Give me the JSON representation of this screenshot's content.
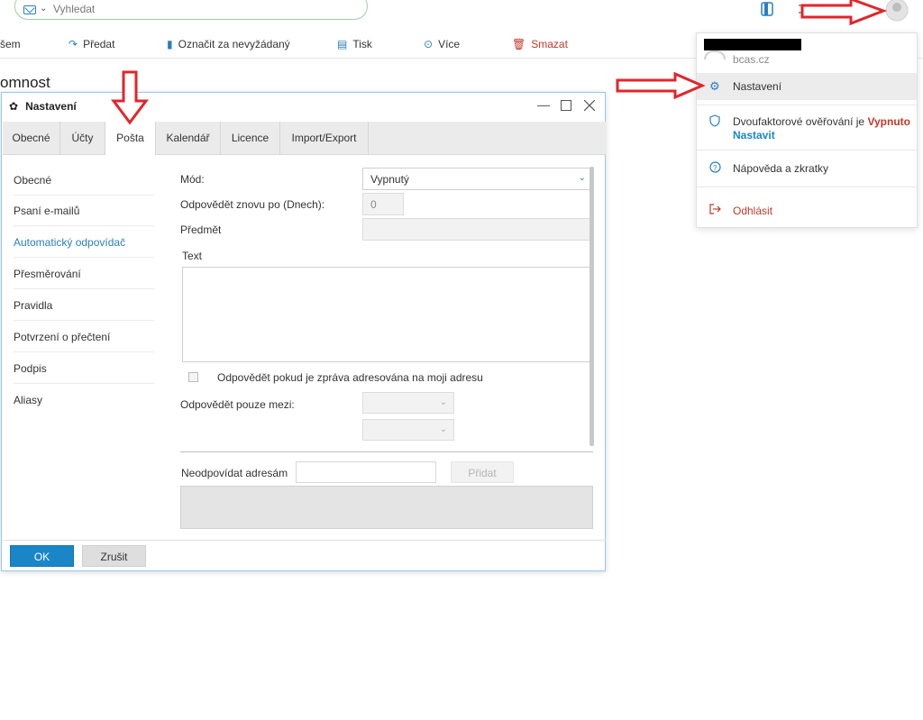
{
  "search": {
    "placeholder": "Vyhledat"
  },
  "toolbar": {
    "items": [
      {
        "label": "šem"
      },
      {
        "label": "Předat"
      },
      {
        "label": "Označit za nevyžádaný"
      },
      {
        "label": "Tisk"
      },
      {
        "label": "Více"
      },
      {
        "label": "Smazat"
      }
    ]
  },
  "background": {
    "heading": "omnost"
  },
  "dialog": {
    "title": "Nastavení",
    "tabs": [
      "Obecné",
      "Účty",
      "Pošta",
      "Kalendář",
      "Licence",
      "Import/Export"
    ],
    "active_tab": "Pošta",
    "sidebar": [
      "Obecné",
      "Psaní e-mailů",
      "Automatický odpovídač",
      "Přesměrování",
      "Pravidla",
      "Potvrzení o přečtení",
      "Podpis",
      "Aliasy"
    ],
    "active_sidebar": "Automatický odpovídač",
    "form": {
      "mode_label": "Mód:",
      "mode_value": "Vypnutý",
      "repeat_label": "Odpovědět znovu po (Dnech):",
      "repeat_value": "0",
      "subject_label": "Předmět",
      "text_label": "Text",
      "only_if_label": "Odpovědět pokud je zpráva adresována na moji adresu",
      "only_between_label": "Odpovědět pouze mezi:",
      "ignore_label": "Neodpovídat adresám",
      "add_button": "Přidat"
    },
    "ok_button": "OK",
    "cancel_button": "Zrušit"
  },
  "menu": {
    "account_domain": "bcas.cz",
    "settings": "Nastavení",
    "twofa_prefix": "Dvoufaktorové ověřování je",
    "twofa_status": "Vypnuto",
    "twofa_action": "Nastavit",
    "help": "Nápověda a zkratky",
    "logout": "Odhlásit"
  },
  "colors": {
    "accent": "#1a86c8",
    "danger": "#c0392b",
    "annotation_arrow": "#e0262b"
  }
}
